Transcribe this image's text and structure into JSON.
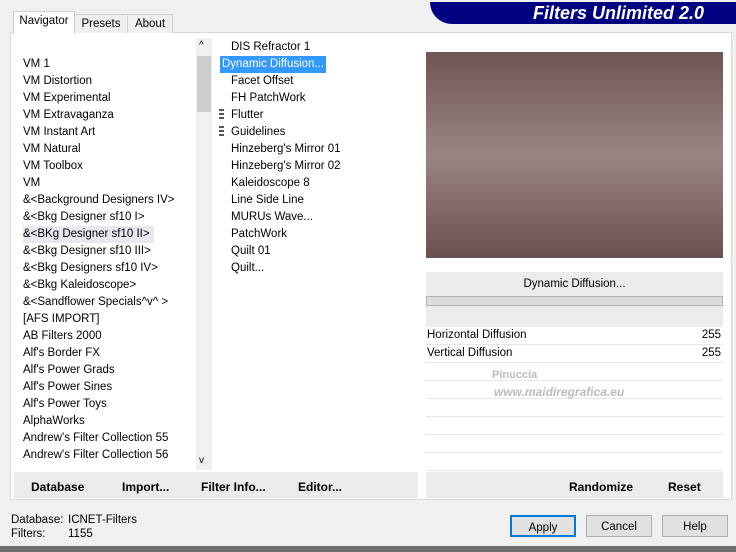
{
  "title": "Filters Unlimited 2.0",
  "tabs": [
    {
      "label": "Navigator"
    },
    {
      "label": "Presets"
    },
    {
      "label": "About"
    }
  ],
  "categories": [
    "VM 1",
    "VM Distortion",
    "VM Experimental",
    "VM Extravaganza",
    "VM Instant Art",
    "VM Natural",
    "VM Toolbox",
    "VM",
    "&<Background Designers IV>",
    "&<Bkg Designer sf10 I>",
    "&<BKg Designer sf10 II>",
    "&<Bkg Designer sf10 III>",
    "&<Bkg Designers sf10 IV>",
    "&<Bkg Kaleidoscope>",
    "&<Sandflower Specials^v^ >",
    "[AFS IMPORT]",
    "AB Filters 2000",
    "Alf's Border FX",
    "Alf's Power Grads",
    "Alf's Power Sines",
    "Alf's Power Toys",
    "AlphaWorks",
    "Andrew's Filter Collection 55",
    "Andrew's Filter Collection 56"
  ],
  "filters": [
    "DIS Refractor 1",
    "Dynamic Diffusion...",
    "Facet Offset",
    "FH PatchWork",
    "Flutter",
    "Guidelines",
    "Hinzeberg's Mirror 01",
    "Hinzeberg's Mirror 02",
    "Kaleidoscope 8",
    "Line Side Line",
    "MURUs Wave...",
    "PatchWork",
    "Quilt 01",
    "Quilt..."
  ],
  "selected_filter": "Dynamic Diffusion...",
  "params": [
    {
      "name": "Horizontal Diffusion",
      "value": "255"
    },
    {
      "name": "Vertical Diffusion",
      "value": "255"
    }
  ],
  "watermark": {
    "line1": "Pinuccia",
    "line2": "www.maidiregrafica.eu"
  },
  "buttons": {
    "database": "Database",
    "import": "Import...",
    "filter_info": "Filter Info...",
    "editor": "Editor...",
    "randomize": "Randomize",
    "reset": "Reset",
    "apply": "Apply",
    "cancel": "Cancel",
    "help": "Help"
  },
  "status": {
    "database_label": "Database:",
    "database_value": "ICNET-Filters",
    "filters_label": "Filters:",
    "filters_value": "1155"
  }
}
